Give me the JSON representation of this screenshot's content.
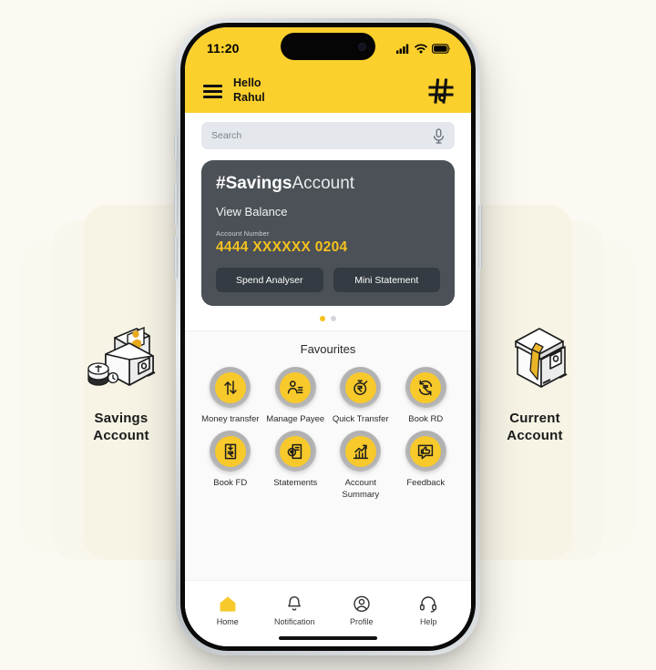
{
  "statusbar": {
    "time": "11:20",
    "icons": [
      "cellular-signal-icon",
      "wifi-icon",
      "battery-icon"
    ]
  },
  "appbar": {
    "menu_icon": "hamburger-menu-icon",
    "greeting_line1": "Hello",
    "greeting_line2": "Rahul",
    "logo": "hash-logo-icon",
    "background_color": "#fbd02d"
  },
  "search": {
    "placeholder": "Search",
    "value": "",
    "mic_icon": "microphone-icon"
  },
  "account_card": {
    "title_bold": "#Savings",
    "title_thin": "Account",
    "balance_link": "View Balance",
    "account_number_label": "Account Number",
    "account_number": "4444 XXXXXX 0204",
    "account_number_color": "#f5c11e",
    "card_color": "#4b5157",
    "buttons": [
      {
        "label": "Spend Analyser"
      },
      {
        "label": "Mini Statement"
      }
    ]
  },
  "pager": {
    "total": 2,
    "active": 1,
    "active_color": "#f5c11e",
    "inactive_color": "#d3d6da"
  },
  "favourites": {
    "title": "Favourites",
    "accent_color": "#f7c92b",
    "items": [
      {
        "label": "Money transfer",
        "icon": "transfer-arrows-icon"
      },
      {
        "label": "Manage Payee",
        "icon": "person-list-icon"
      },
      {
        "label": "Quick Transfer",
        "icon": "stopwatch-rupee-icon"
      },
      {
        "label": "Book RD",
        "icon": "recurring-rupee-icon"
      },
      {
        "label": "Book FD",
        "icon": "deposit-rupee-icon"
      },
      {
        "label": "Statements",
        "icon": "document-rupee-icon"
      },
      {
        "label": "Account Summary",
        "icon": "bar-chart-trend-icon"
      },
      {
        "label": "Feedback",
        "icon": "thumbs-up-bubble-icon"
      }
    ]
  },
  "bottom_nav": {
    "items": [
      {
        "label": "Home",
        "icon": "home-icon",
        "active": true
      },
      {
        "label": "Notification",
        "icon": "bell-icon",
        "active": false
      },
      {
        "label": "Profile",
        "icon": "user-circle-icon",
        "active": false
      },
      {
        "label": "Help",
        "icon": "headset-icon",
        "active": false
      }
    ],
    "active_color": "#f7c92b"
  },
  "side_panels": {
    "left": {
      "label_line1": "Savings",
      "label_line2": "Account",
      "icon": "wallet-coins-illustration"
    },
    "right": {
      "label_line1": "Current",
      "label_line2": "Account",
      "icon": "wallet-necktie-illustration"
    }
  }
}
